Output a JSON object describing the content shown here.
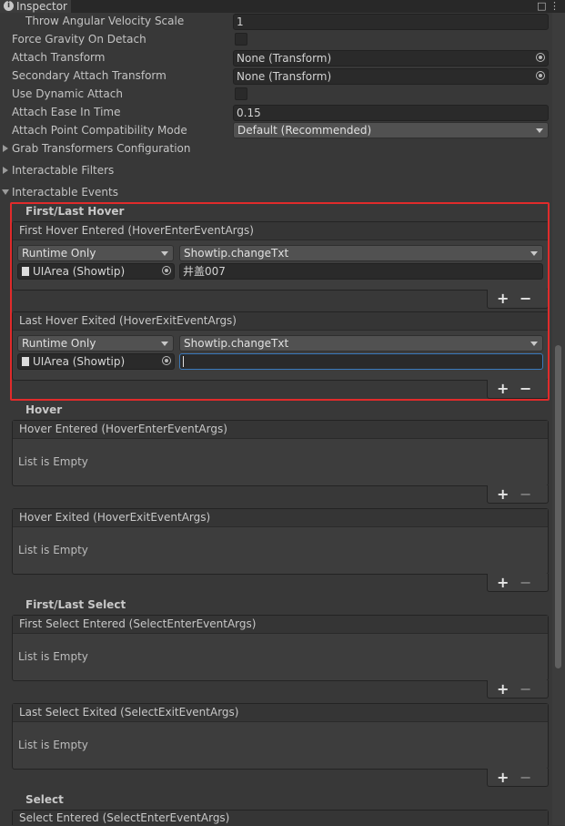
{
  "tab": {
    "title": "Inspector",
    "info_icon": "i"
  },
  "tab_icons": {
    "lock": "□",
    "menu": "⋮"
  },
  "properties": {
    "throw_angular_label": "Throw Angular Velocity Scale",
    "throw_angular_value": "1",
    "force_gravity_label": "Force Gravity On Detach",
    "attach_transform_label": "Attach Transform",
    "attach_transform_value": "None (Transform)",
    "secondary_attach_label": "Secondary Attach Transform",
    "secondary_attach_value": "None (Transform)",
    "use_dynamic_label": "Use Dynamic Attach",
    "ease_in_label": "Attach Ease In Time",
    "ease_in_value": "0.15",
    "compat_mode_label": "Attach Point Compatibility Mode",
    "compat_mode_value": "Default (Recommended)"
  },
  "foldouts": {
    "grab": "Grab Transformers Configuration",
    "filters": "Interactable Filters",
    "events": "Interactable Events"
  },
  "sections": {
    "first_last_hover": "First/Last Hover",
    "hover": "Hover",
    "first_last_select": "First/Last Select",
    "select": "Select"
  },
  "events": {
    "first_hover_entered": {
      "header": "First Hover Entered (HoverEnterEventArgs)",
      "runtime": "Runtime Only",
      "function": "Showtip.changeTxt",
      "object": "UIArea (Showtip)",
      "argument": "井盖007"
    },
    "last_hover_exited": {
      "header": "Last Hover Exited (HoverExitEventArgs)",
      "runtime": "Runtime Only",
      "function": "Showtip.changeTxt",
      "object": "UIArea (Showtip)",
      "argument": ""
    },
    "hover_entered": {
      "header": "Hover Entered (HoverEnterEventArgs)",
      "empty": "List is Empty"
    },
    "hover_exited": {
      "header": "Hover Exited (HoverExitEventArgs)",
      "empty": "List is Empty"
    },
    "first_select_entered": {
      "header": "First Select Entered (SelectEnterEventArgs)",
      "empty": "List is Empty"
    },
    "last_select_exited": {
      "header": "Last Select Exited (SelectExitEventArgs)",
      "empty": "List is Empty"
    },
    "select_entered": {
      "header": "Select Entered (SelectEnterEventArgs)"
    }
  },
  "buttons": {
    "plus": "+",
    "minus": "−"
  },
  "colors": {
    "background": "#383838",
    "highlight": "#e02b2b",
    "focus": "#3a79bb"
  }
}
